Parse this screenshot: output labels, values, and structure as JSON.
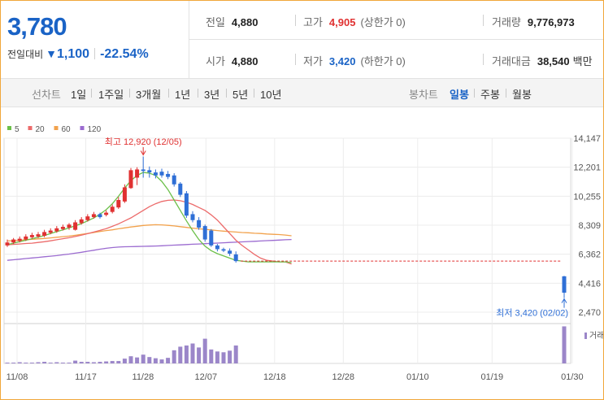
{
  "header": {
    "price": "3,780",
    "change_label": "전일대비",
    "change_arrow": "▼",
    "change_amount": "1,100",
    "change_percent": "-22.54%",
    "stats": {
      "prev_close": {
        "label": "전일",
        "value": "4,880"
      },
      "high": {
        "label": "고가",
        "value": "4,905",
        "sub": "(상한가 0)"
      },
      "volume": {
        "label": "거래량",
        "value": "9,776,973"
      },
      "open": {
        "label": "시가",
        "value": "4,880"
      },
      "low": {
        "label": "저가",
        "value": "3,420",
        "sub": "(하한가 0)"
      },
      "amount": {
        "label": "거래대금",
        "value": "38,540",
        "unit": "백만"
      }
    }
  },
  "tabs": {
    "line_label": "선차트",
    "periods": [
      "1일",
      "1주일",
      "3개월",
      "1년",
      "3년",
      "5년",
      "10년"
    ],
    "candle_label": "봉차트",
    "candle_periods": [
      "일봉",
      "주봉",
      "월봉"
    ],
    "active_candle": "일봉"
  },
  "colors": {
    "up": "#e03131",
    "down": "#2f6fd6",
    "ma5": "#6cc04a",
    "ma20": "#ec6b6b",
    "ma60": "#f2a24c",
    "ma120": "#9b6bd0",
    "volume": "#9b86c9",
    "accent": "#1a63c6"
  },
  "chart_data": {
    "type": "candlestick",
    "legend": [
      "5",
      "20",
      "60",
      "120"
    ],
    "y_ticks": [
      "14,147",
      "12,201",
      "10,255",
      "8,309",
      "6,362",
      "4,416",
      "2,470"
    ],
    "ylim": [
      2470,
      14147
    ],
    "x_ticks": [
      "11/08",
      "11/17",
      "11/28",
      "12/07",
      "12/18",
      "12/28",
      "01/10",
      "01/19",
      "01/30"
    ],
    "annotation_high": "최고 12,920 (12/05)",
    "annotation_low": "최저 3,420 (02/02)",
    "volume_label": "거래",
    "candles": [
      {
        "o": 6950,
        "c": 7150,
        "h": 7350,
        "l": 6850,
        "v": 0.02
      },
      {
        "o": 7150,
        "c": 7350,
        "h": 7450,
        "l": 7050,
        "v": 0.02
      },
      {
        "o": 7250,
        "c": 7400,
        "h": 7550,
        "l": 7150,
        "v": 0.03
      },
      {
        "o": 7350,
        "c": 7550,
        "h": 7700,
        "l": 7250,
        "v": 0.02
      },
      {
        "o": 7500,
        "c": 7650,
        "h": 7800,
        "l": 7400,
        "v": 0.02
      },
      {
        "o": 7550,
        "c": 7700,
        "h": 7850,
        "l": 7450,
        "v": 0.03
      },
      {
        "o": 7600,
        "c": 7850,
        "h": 8000,
        "l": 7500,
        "v": 0.04
      },
      {
        "o": 7800,
        "c": 7950,
        "h": 8100,
        "l": 7700,
        "v": 0.02
      },
      {
        "o": 7900,
        "c": 8100,
        "h": 8250,
        "l": 7800,
        "v": 0.03
      },
      {
        "o": 8050,
        "c": 8200,
        "h": 8350,
        "l": 7950,
        "v": 0.02
      },
      {
        "o": 8150,
        "c": 8350,
        "h": 8450,
        "l": 8000,
        "v": 0.02
      },
      {
        "o": 8000,
        "c": 8500,
        "h": 8650,
        "l": 7950,
        "v": 0.07
      },
      {
        "o": 8450,
        "c": 8700,
        "h": 8850,
        "l": 8350,
        "v": 0.04
      },
      {
        "o": 8650,
        "c": 8900,
        "h": 9050,
        "l": 8550,
        "v": 0.04
      },
      {
        "o": 8850,
        "c": 9050,
        "h": 9200,
        "l": 8750,
        "v": 0.03
      },
      {
        "o": 9050,
        "c": 8850,
        "h": 9150,
        "l": 8750,
        "v": 0.04
      },
      {
        "o": 9000,
        "c": 9150,
        "h": 9300,
        "l": 8900,
        "v": 0.05
      },
      {
        "o": 9200,
        "c": 9550,
        "h": 9700,
        "l": 9100,
        "v": 0.06
      },
      {
        "o": 9500,
        "c": 10000,
        "h": 10200,
        "l": 9400,
        "v": 0.06
      },
      {
        "o": 9900,
        "c": 10850,
        "h": 11050,
        "l": 9800,
        "v": 0.12
      },
      {
        "o": 10800,
        "c": 12000,
        "h": 12150,
        "l": 10750,
        "v": 0.18
      },
      {
        "o": 11500,
        "c": 12050,
        "h": 12200,
        "l": 11000,
        "v": 0.15
      },
      {
        "o": 12050,
        "c": 11950,
        "h": 12920,
        "l": 11500,
        "v": 0.22
      },
      {
        "o": 12000,
        "c": 11850,
        "h": 12250,
        "l": 11500,
        "v": 0.16
      },
      {
        "o": 11850,
        "c": 11650,
        "h": 12050,
        "l": 11450,
        "v": 0.13
      },
      {
        "o": 11900,
        "c": 11650,
        "h": 12100,
        "l": 11500,
        "v": 0.1
      },
      {
        "o": 11750,
        "c": 11550,
        "h": 11950,
        "l": 11400,
        "v": 0.14
      },
      {
        "o": 11650,
        "c": 11050,
        "h": 11800,
        "l": 10900,
        "v": 0.33
      },
      {
        "o": 11100,
        "c": 10350,
        "h": 11200,
        "l": 10200,
        "v": 0.42
      },
      {
        "o": 10450,
        "c": 8950,
        "h": 10600,
        "l": 8800,
        "v": 0.45
      },
      {
        "o": 9050,
        "c": 8650,
        "h": 9250,
        "l": 8500,
        "v": 0.5
      },
      {
        "o": 8650,
        "c": 8150,
        "h": 8850,
        "l": 8000,
        "v": 0.4
      },
      {
        "o": 8250,
        "c": 7350,
        "h": 8350,
        "l": 7200,
        "v": 0.62
      },
      {
        "o": 7950,
        "c": 6950,
        "h": 8050,
        "l": 6850,
        "v": 0.35
      },
      {
        "o": 6950,
        "c": 6700,
        "h": 7050,
        "l": 6550,
        "v": 0.3
      },
      {
        "o": 6700,
        "c": 6600,
        "h": 6800,
        "l": 6500,
        "v": 0.28
      },
      {
        "o": 6600,
        "c": 6400,
        "h": 6750,
        "l": 6250,
        "v": 0.32
      },
      {
        "o": 6350,
        "c": 5900,
        "h": 6550,
        "l": 5800,
        "v": 0.45
      },
      {
        "o": 4880,
        "c": 3780,
        "h": 4905,
        "l": 3420,
        "v": 0.93
      }
    ],
    "ma5": [
      7000,
      7100,
      7200,
      7300,
      7400,
      7500,
      7620,
      7750,
      7880,
      8000,
      8130,
      8270,
      8420,
      8600,
      8800,
      9050,
      9350,
      9750,
      10250,
      10800,
      11300,
      11650,
      11850,
      11800,
      11650,
      11250,
      10700,
      10000,
      9300,
      8600,
      7950,
      7350,
      6900,
      6600,
      6400,
      6250,
      6100,
      5950,
      5900,
      5850,
      5850,
      5850,
      5850,
      5850,
      5850,
      5850,
      5800
    ],
    "ma20": [
      7000,
      7020,
      7050,
      7080,
      7100,
      7150,
      7200,
      7260,
      7330,
      7400,
      7470,
      7550,
      7640,
      7740,
      7850,
      7960,
      8080,
      8230,
      8400,
      8600,
      8800,
      9050,
      9300,
      9550,
      9750,
      9900,
      9980,
      10000,
      9950,
      9850,
      9700,
      9500,
      9300,
      9000,
      8650,
      8200,
      7750,
      7300,
      6950,
      6650,
      6350,
      6100,
      5950,
      5900,
      5850,
      5850,
      5700
    ],
    "ma60": [
      7250,
      7270,
      7300,
      7330,
      7360,
      7390,
      7420,
      7460,
      7500,
      7540,
      7580,
      7630,
      7690,
      7750,
      7820,
      7890,
      7950,
      8000,
      8070,
      8130,
      8190,
      8240,
      8290,
      8320,
      8340,
      8330,
      8300,
      8260,
      8210,
      8160,
      8110,
      8070,
      8030,
      7990,
      7950,
      7910,
      7880,
      7850,
      7820,
      7800,
      7770,
      7750,
      7720,
      7700,
      7680,
      7650,
      7600
    ],
    "ma120": [
      5950,
      5990,
      6030,
      6070,
      6110,
      6150,
      6190,
      6230,
      6270,
      6320,
      6370,
      6430,
      6490,
      6560,
      6630,
      6700,
      6760,
      6810,
      6840,
      6860,
      6870,
      6880,
      6890,
      6900,
      6910,
      6930,
      6950,
      6970,
      6990,
      7010,
      7030,
      7050,
      7070,
      7090,
      7110,
      7130,
      7150,
      7170,
      7190,
      7210,
      7230,
      7250,
      7270,
      7290,
      7310,
      7330,
      7350
    ]
  }
}
